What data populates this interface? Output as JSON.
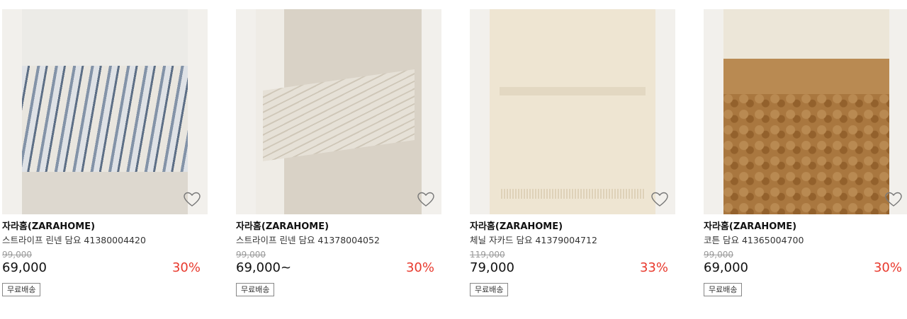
{
  "products": [
    {
      "brand": "자라홈(ZARAHOME)",
      "name": "스트라이프 린넨 담요 41380004420",
      "original_price": "99,000",
      "price": "69,000",
      "discount": "30%",
      "badge": "무료배송",
      "image_alt": "Blue and white striped linen blanket on a sofa",
      "wishlist_icon": "heart-outline-icon"
    },
    {
      "brand": "자라홈(ZARAHOME)",
      "name": "스트라이프 린넨 담요 41378004052",
      "original_price": "99,000",
      "price": "69,000~",
      "discount": "30%",
      "badge": "무료배송",
      "image_alt": "Beige striped linen blanket on a sofa",
      "wishlist_icon": "heart-outline-icon"
    },
    {
      "brand": "자라홈(ZARAHOME)",
      "name": "체닐 자카드 담요 41379004712",
      "original_price": "119,000",
      "price": "79,000",
      "discount": "33%",
      "badge": "무료배송",
      "image_alt": "Cream chenille jacquard blanket with fringe",
      "wishlist_icon": "heart-outline-icon"
    },
    {
      "brand": "자라홈(ZARAHOME)",
      "name": "코튼 담요 41365004700",
      "original_price": "99,000",
      "price": "69,000",
      "discount": "30%",
      "badge": "무료배송",
      "image_alt": "Brown textured cotton blanket",
      "wishlist_icon": "heart-outline-icon"
    }
  ],
  "colors": {
    "discount": "#e8392d",
    "original_price": "#9a9a9a"
  }
}
